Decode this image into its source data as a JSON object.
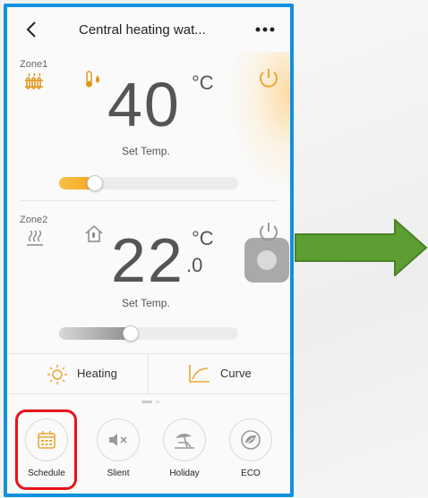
{
  "header": {
    "title": "Central heating wat..."
  },
  "zone1": {
    "label": "Zone1",
    "temperature": "40",
    "unit": "°C",
    "set_temp_label": "Set Temp.",
    "slider_fraction": 0.2,
    "accent": "#f5a623"
  },
  "zone2": {
    "label": "Zone2",
    "temperature": "22",
    "decimal": ".0",
    "unit": "°C",
    "set_temp_label": "Set Temp.",
    "slider_fraction": 0.4
  },
  "tabs": [
    {
      "label": "Heating",
      "icon": "sun-icon"
    },
    {
      "label": "Curve",
      "icon": "curve-chart-icon"
    }
  ],
  "bottom_buttons": [
    {
      "label": "Schedule",
      "icon": "calendar-icon",
      "highlighted": true
    },
    {
      "label": "Slient",
      "icon": "speaker-mute-icon"
    },
    {
      "label": "Holiday",
      "icon": "beach-umbrella-icon"
    },
    {
      "label": "ECO",
      "icon": "eco-leaf-icon"
    }
  ],
  "colors": {
    "frame": "#1190e0",
    "highlight": "#e8121a",
    "arrow": "#5c9e31",
    "orange": "#f5a623"
  }
}
